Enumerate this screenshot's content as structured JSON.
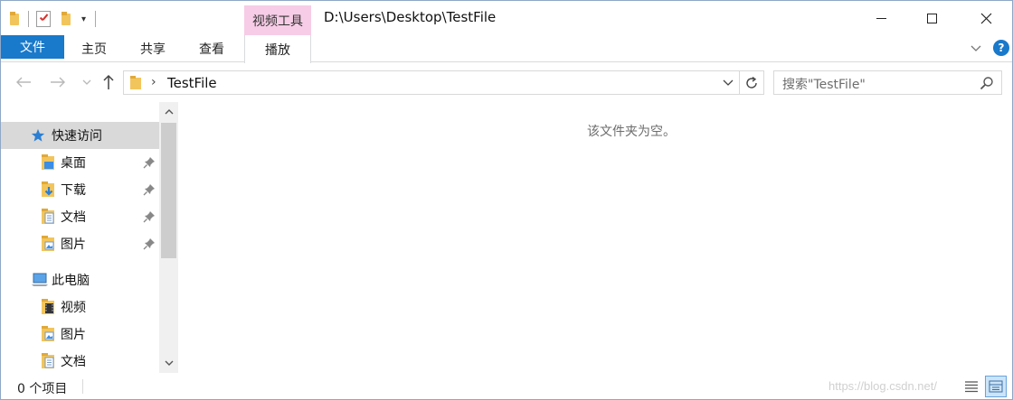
{
  "titlebar": {
    "context_tab_header": "视频工具",
    "path": "D:\\Users\\Desktop\\TestFile",
    "qat_icons": [
      "folder-icon",
      "properties-icon",
      "new-folder-icon",
      "customize-dropdown-icon"
    ]
  },
  "ribbon": {
    "tabs": [
      {
        "label": "文件",
        "active": true
      },
      {
        "label": "主页"
      },
      {
        "label": "共享"
      },
      {
        "label": "查看"
      },
      {
        "label": "播放"
      }
    ],
    "help": "?"
  },
  "address": {
    "crumb": "TestFile",
    "search_placeholder": "搜索\"TestFile\""
  },
  "sidebar": {
    "items": [
      {
        "label": "快速访问",
        "icon": "star-icon",
        "selected": true
      },
      {
        "label": "桌面",
        "icon": "desktop-folder-icon",
        "pinned": true
      },
      {
        "label": "下载",
        "icon": "downloads-folder-icon",
        "pinned": true
      },
      {
        "label": "文档",
        "icon": "documents-folder-icon",
        "pinned": true
      },
      {
        "label": "图片",
        "icon": "pictures-folder-icon",
        "pinned": true
      },
      {
        "label": "此电脑",
        "icon": "computer-icon"
      },
      {
        "label": "视频",
        "icon": "videos-folder-icon"
      },
      {
        "label": "图片",
        "icon": "pictures-folder-icon"
      },
      {
        "label": "文档",
        "icon": "documents-folder-icon"
      }
    ]
  },
  "content": {
    "empty_message": "该文件夹为空。"
  },
  "status": {
    "count": "0 个项目",
    "watermark": "https://blog.csdn.net/"
  },
  "colors": {
    "accent": "#1979ca",
    "context_tab": "#f6cce6",
    "selected_bg": "#d9d9d9"
  }
}
